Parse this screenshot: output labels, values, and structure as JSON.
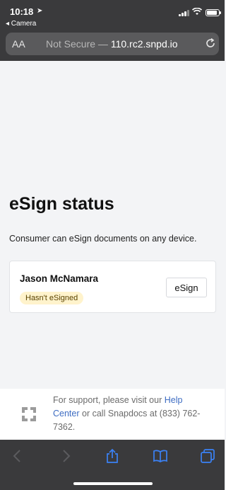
{
  "status_bar": {
    "time": "10:18",
    "back_app": "◂ Camera"
  },
  "browser": {
    "text_size_label": "AA",
    "url_prefix": "Not Secure — ",
    "url_host": "110.rc2.snpd.io"
  },
  "page": {
    "title": "eSign status",
    "subtitle": "Consumer can eSign documents on any device."
  },
  "card": {
    "consumer_name": "Jason McNamara",
    "status_badge": "Hasn't eSigned",
    "esign_button": "eSign"
  },
  "support": {
    "text_before": "For support, please visit our ",
    "link": "Help Center",
    "text_after": " or call Snapdocs at (833) 762-7362."
  },
  "colors": {
    "chrome": "#3a3a3c",
    "link": "#3d6cc2",
    "badge_bg": "#fff3cc",
    "toolbar_icon": "#3b82f6"
  },
  "icons": [
    "location-arrow-icon",
    "signal-icon",
    "wifi-icon",
    "battery-icon",
    "reload-icon",
    "snapdocs-logo-icon",
    "back-icon",
    "forward-icon",
    "share-icon",
    "bookmarks-icon",
    "tabs-icon"
  ]
}
